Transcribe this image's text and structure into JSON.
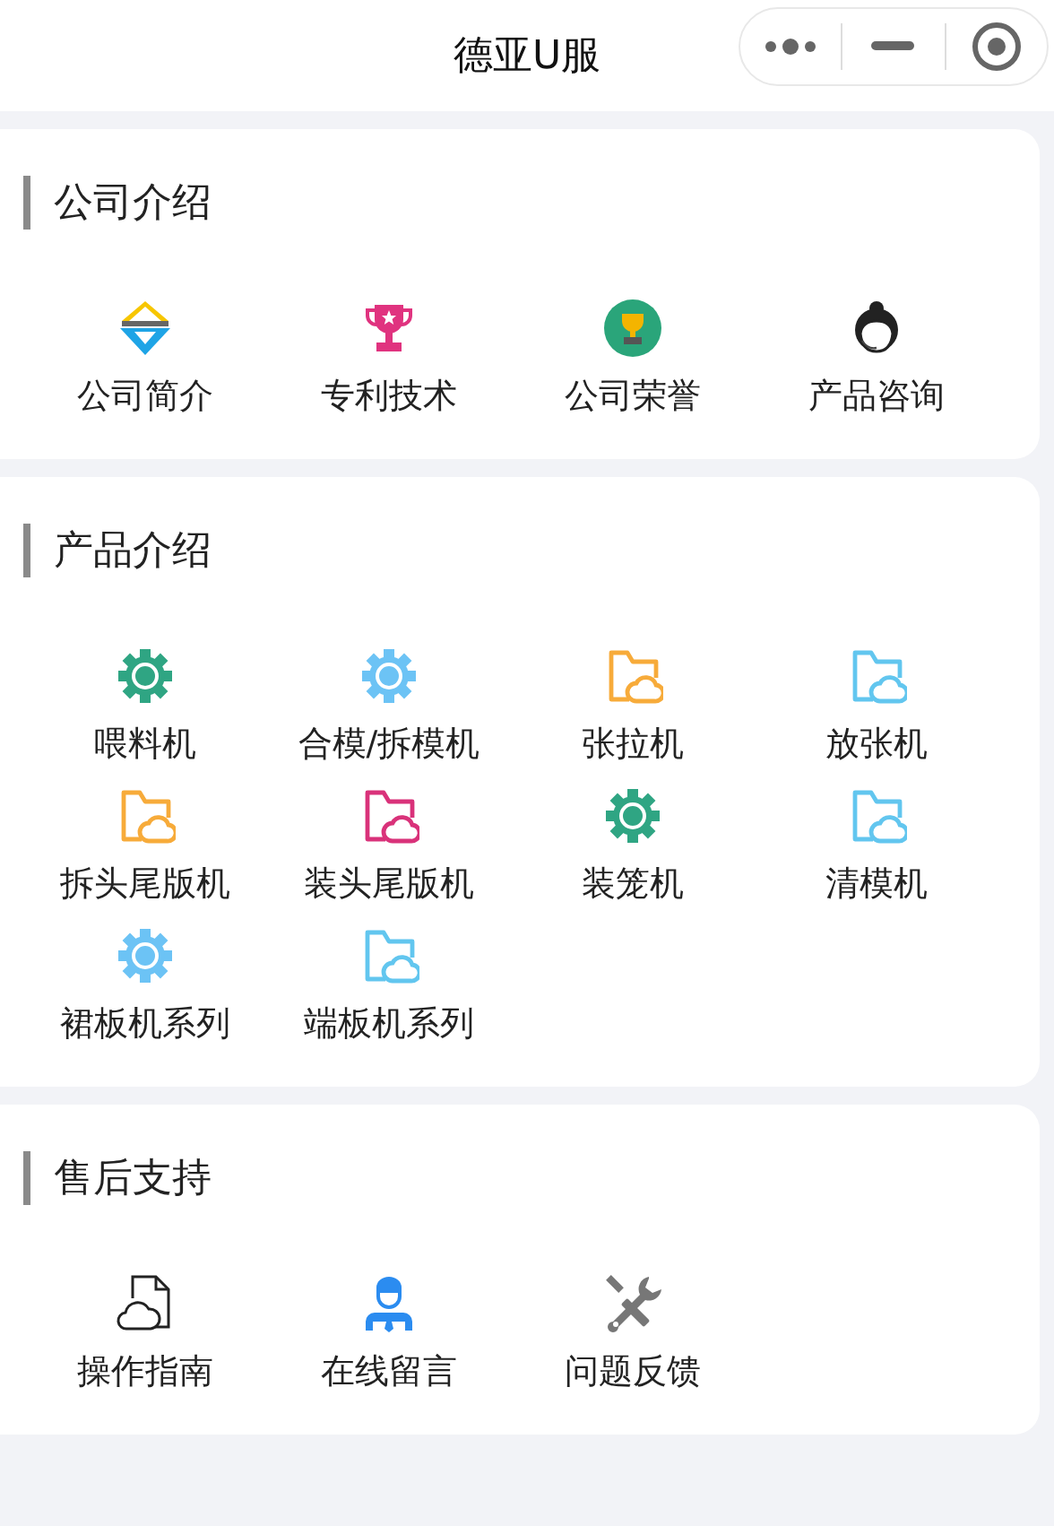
{
  "header": {
    "title": "德亚U服"
  },
  "sections": [
    {
      "title": "公司介绍",
      "items": [
        {
          "label": "公司简介",
          "kind": "diamond"
        },
        {
          "label": "专利技术",
          "kind": "trophy",
          "color": "#e0337f"
        },
        {
          "label": "公司荣誉",
          "kind": "badge",
          "color": "#2aa57a"
        },
        {
          "label": "产品咨询",
          "kind": "agent"
        }
      ]
    },
    {
      "title": "产品介绍",
      "items": [
        {
          "label": "喂料机",
          "kind": "gear",
          "color": "#2fa583"
        },
        {
          "label": "合模/拆模机",
          "kind": "gear",
          "color": "#6cc3f5"
        },
        {
          "label": "张拉机",
          "kind": "folder",
          "color": "#f7ab3a"
        },
        {
          "label": "放张机",
          "kind": "folder",
          "color": "#62c6ef"
        },
        {
          "label": "拆头尾版机",
          "kind": "folder",
          "color": "#f7ab3a"
        },
        {
          "label": "装头尾版机",
          "kind": "folder",
          "color": "#d9327a"
        },
        {
          "label": "装笼机",
          "kind": "gear",
          "color": "#2fa583"
        },
        {
          "label": "清模机",
          "kind": "folder",
          "color": "#62c6ef"
        },
        {
          "label": "裙板机系列",
          "kind": "gear",
          "color": "#6cc3f5"
        },
        {
          "label": "端板机系列",
          "kind": "folder",
          "color": "#62c6ef"
        }
      ]
    },
    {
      "title": "售后支持",
      "items": [
        {
          "label": "操作指南",
          "kind": "doc"
        },
        {
          "label": "在线留言",
          "kind": "user",
          "color": "#2b8cf0"
        },
        {
          "label": "问题反馈",
          "kind": "tools",
          "color": "#777777"
        }
      ]
    }
  ]
}
